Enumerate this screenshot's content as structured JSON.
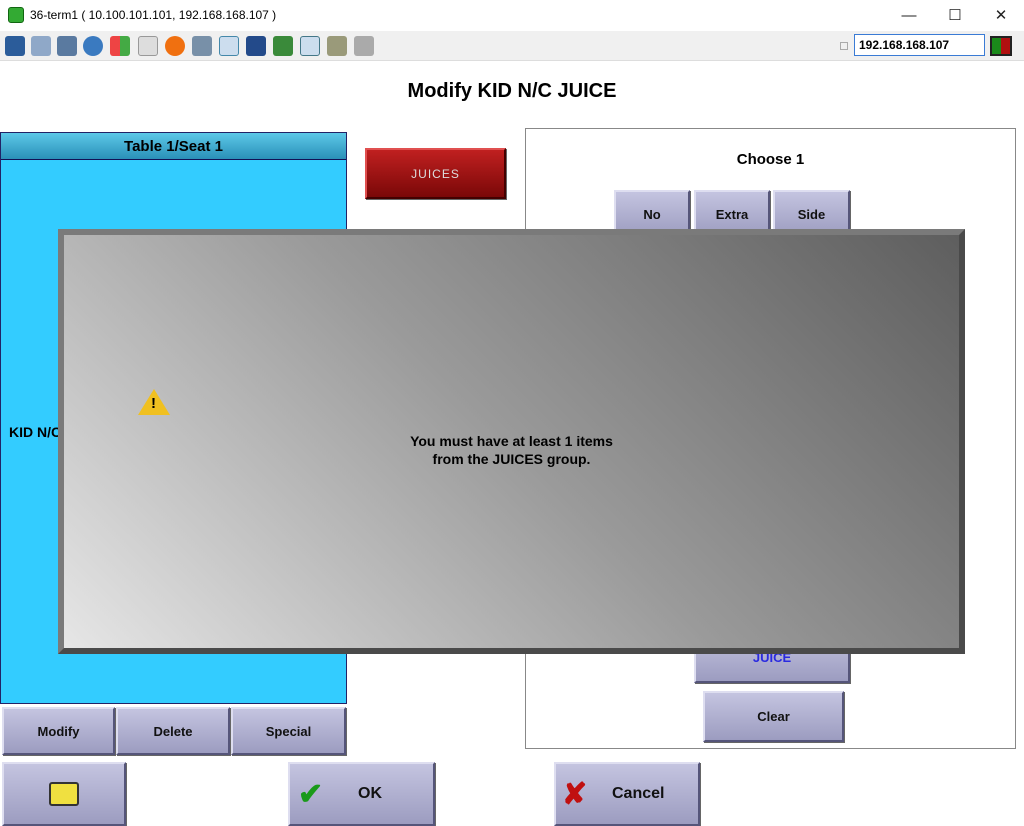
{
  "window": {
    "title": "36-term1 ( 10.100.101.101, 192.168.168.107 )",
    "minimize": "—",
    "maximize": "☐",
    "close": "✕"
  },
  "toolbar": {
    "ip": "192.168.168.107",
    "icons": [
      "monitor-activity-icon",
      "windows-icon",
      "tools-icon",
      "refresh-icon",
      "windows-logo-icon",
      "keyboard-icon",
      "alert-icon",
      "disconnect-icon",
      "fullscreen-icon",
      "display-icon",
      "transfer-icon",
      "new-window-icon",
      "screen-icon",
      "chat-icon"
    ]
  },
  "heading": "Modify KID N/C JUICE",
  "left": {
    "header": "Table 1/Seat 1",
    "item": "KID N/C JUICE"
  },
  "group_button": "JUICES",
  "right": {
    "title": "Choose 1",
    "options": [
      "No",
      "Extra",
      "Side"
    ],
    "item": "JUICE",
    "clear": "Clear"
  },
  "actions": {
    "modify": "Modify",
    "delete": "Delete",
    "special": "Special",
    "ok": "OK",
    "cancel": "Cancel"
  },
  "dialog": {
    "line1": "You must have at least 1 items",
    "line2": "from the JUICES group."
  },
  "colors": {
    "panel": "#33ccff",
    "juices": "#a01010"
  }
}
